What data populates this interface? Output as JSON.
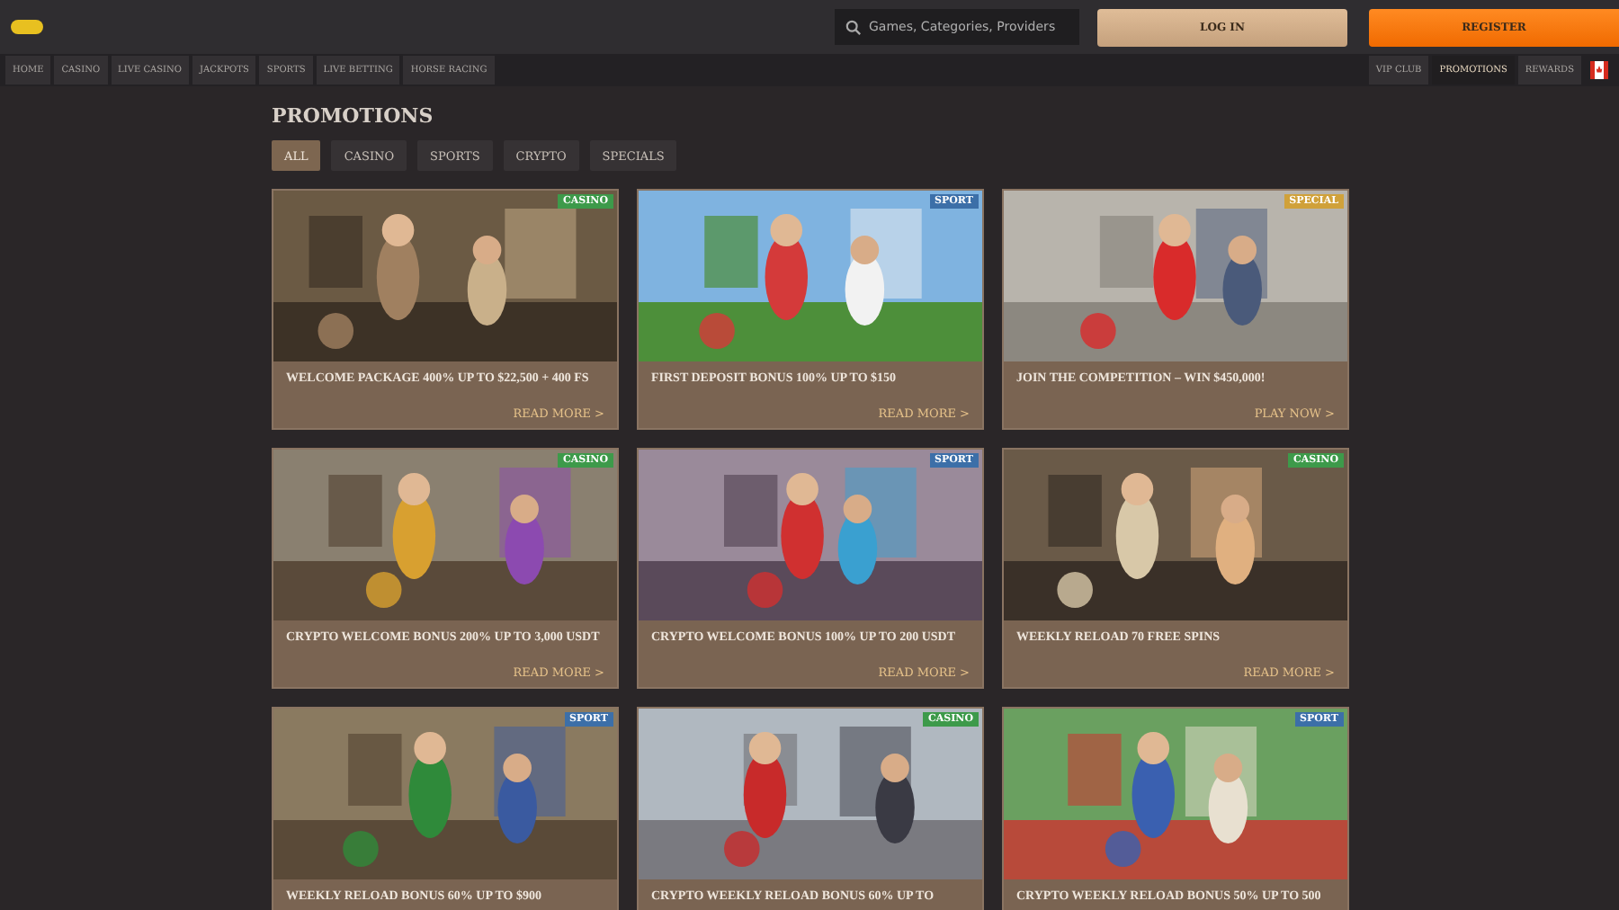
{
  "header": {
    "search": {
      "placeholder": "Games, Categories, Providers"
    },
    "login": "LOG IN",
    "register": "REGISTER"
  },
  "nav_left": [
    {
      "label": "HOME"
    },
    {
      "label": "CASINO"
    },
    {
      "label": "LIVE CASINO"
    },
    {
      "label": "JACKPOTS"
    },
    {
      "label": "SPORTS"
    },
    {
      "label": "LIVE BETTING"
    },
    {
      "label": "HORSE RACING"
    }
  ],
  "nav_right": [
    {
      "label": "VIP CLUB",
      "selected": false
    },
    {
      "label": "PROMOTIONS",
      "selected": true
    },
    {
      "label": "REWARDS",
      "selected": false
    }
  ],
  "title": "PROMOTIONS",
  "filters": [
    {
      "label": "ALL",
      "selected": true
    },
    {
      "label": "CASINO",
      "selected": false
    },
    {
      "label": "SPORTS",
      "selected": false
    },
    {
      "label": "CRYPTO",
      "selected": false
    },
    {
      "label": "SPECIALS",
      "selected": false
    }
  ],
  "cards": [
    {
      "tag": "CASINO",
      "color": "#3d9a4a",
      "title": "WELCOME PACKAGE 400% UP TO $22,500 + 400 FS",
      "link": "READ MORE >"
    },
    {
      "tag": "SPORT",
      "color": "#3c6fa8",
      "title": "FIRST DEPOSIT BONUS 100% UP TO $150",
      "link": "READ MORE >"
    },
    {
      "tag": "SPECIAL",
      "color": "#d0a13a",
      "title": "JOIN THE COMPETITION – WIN $450,000!",
      "link": "PLAY NOW >"
    },
    {
      "tag": "CASINO",
      "color": "#3d9a4a",
      "title": "CRYPTO WELCOME BONUS 200% UP TO 3,000 USDT",
      "link": "READ MORE >"
    },
    {
      "tag": "SPORT",
      "color": "#3c6fa8",
      "title": "CRYPTO WELCOME BONUS 100% UP TO 200 USDT",
      "link": "READ MORE >"
    },
    {
      "tag": "CASINO",
      "color": "#3d9a4a",
      "title": "WEEKLY RELOAD 70 FREE SPINS",
      "link": "READ MORE >"
    },
    {
      "tag": "SPORT",
      "color": "#3c6fa8",
      "title": "WEEKLY RELOAD BONUS 60% UP TO $900"
    },
    {
      "tag": "CASINO",
      "color": "#3d9a4a",
      "title": "CRYPTO WEEKLY RELOAD BONUS 60% UP TO"
    },
    {
      "tag": "SPORT",
      "color": "#3c6fa8",
      "title": "CRYPTO WEEKLY RELOAD BONUS 50% UP TO 500"
    }
  ]
}
